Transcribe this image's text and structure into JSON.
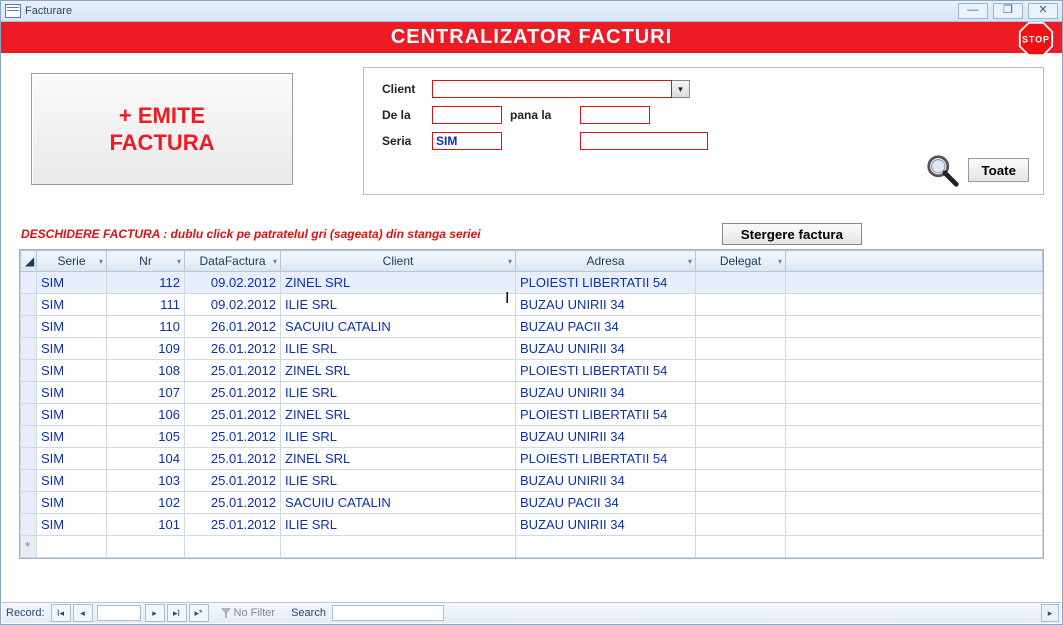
{
  "window_title": "Facturare",
  "header_title": "CENTRALIZATOR  FACTURI",
  "emite_button": "+ EMITE\nFACTURA",
  "filter": {
    "client_label": "Client",
    "client_value": "",
    "dela_label": "De la",
    "dela_value": "",
    "panala_label": "pana la",
    "panala_value": "",
    "seria_label": "Seria",
    "seria_value": "SIM",
    "seria2_value": "",
    "toate_label": "Toate"
  },
  "hint_text": "DESCHIDERE FACTURA : dublu click pe patratelul gri (sageata) din stanga seriei",
  "delete_button": "Stergere factura",
  "columns": {
    "serie": "Serie",
    "nr": "Nr",
    "data": "DataFactura",
    "client": "Client",
    "adresa": "Adresa",
    "delegat": "Delegat"
  },
  "rows": [
    {
      "serie": "SIM",
      "nr": "112",
      "data": "09.02.2012",
      "client": "ZINEL SRL",
      "adresa": "PLOIESTI LIBERTATII 54",
      "delegat": ""
    },
    {
      "serie": "SIM",
      "nr": "111",
      "data": "09.02.2012",
      "client": "ILIE SRL",
      "adresa": "BUZAU UNIRII 34",
      "delegat": ""
    },
    {
      "serie": "SIM",
      "nr": "110",
      "data": "26.01.2012",
      "client": "SACUIU CATALIN",
      "adresa": "BUZAU PACII 34",
      "delegat": ""
    },
    {
      "serie": "SIM",
      "nr": "109",
      "data": "26.01.2012",
      "client": "ILIE SRL",
      "adresa": "BUZAU UNIRII 34",
      "delegat": ""
    },
    {
      "serie": "SIM",
      "nr": "108",
      "data": "25.01.2012",
      "client": "ZINEL SRL",
      "adresa": "PLOIESTI LIBERTATII 54",
      "delegat": ""
    },
    {
      "serie": "SIM",
      "nr": "107",
      "data": "25.01.2012",
      "client": "ILIE SRL",
      "adresa": "BUZAU UNIRII 34",
      "delegat": ""
    },
    {
      "serie": "SIM",
      "nr": "106",
      "data": "25.01.2012",
      "client": "ZINEL SRL",
      "adresa": "PLOIESTI LIBERTATII 54",
      "delegat": ""
    },
    {
      "serie": "SIM",
      "nr": "105",
      "data": "25.01.2012",
      "client": "ILIE SRL",
      "adresa": "BUZAU UNIRII 34",
      "delegat": ""
    },
    {
      "serie": "SIM",
      "nr": "104",
      "data": "25.01.2012",
      "client": "ZINEL SRL",
      "adresa": "PLOIESTI LIBERTATII 54",
      "delegat": ""
    },
    {
      "serie": "SIM",
      "nr": "103",
      "data": "25.01.2012",
      "client": "ILIE SRL",
      "adresa": "BUZAU UNIRII 34",
      "delegat": ""
    },
    {
      "serie": "SIM",
      "nr": "102",
      "data": "25.01.2012",
      "client": "SACUIU CATALIN",
      "adresa": "BUZAU PACII 34",
      "delegat": ""
    },
    {
      "serie": "SIM",
      "nr": "101",
      "data": "25.01.2012",
      "client": "ILIE SRL",
      "adresa": "BUZAU UNIRII 34",
      "delegat": ""
    }
  ],
  "recnav": {
    "label": "Record:",
    "nofilter": "No Filter",
    "search": "Search"
  }
}
